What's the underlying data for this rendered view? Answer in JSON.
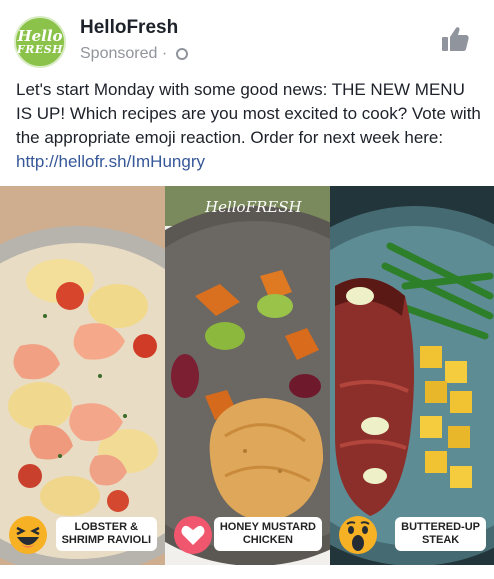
{
  "post": {
    "page_name": "HelloFresh",
    "logo_line1": "Hello",
    "logo_line2": "FRESH",
    "meta_text": "Sponsored · ",
    "caption_text": "Let's start Monday with some good news: THE NEW MENU IS UP! Which recipes are you most excited to cook? Vote with the appropriate emoji reaction. Order for next week here: ",
    "link_text": "http://hellofr.sh/ImHungry",
    "icons": [
      "globe-icon",
      "thumbs-up-icon"
    ]
  },
  "photos": [
    {
      "label_line1": "LOBSTER &",
      "label_line2": "SHRIMP RAVIOLI",
      "reaction": "haha-emoji"
    },
    {
      "label_line1": "HONEY MUSTARD",
      "label_line2": "CHICKEN",
      "reaction": "love-emoji"
    },
    {
      "label_line1": "BUTTERED-UP",
      "label_line2": "STEAK",
      "reaction": "wow-emoji"
    }
  ],
  "watermark": "HelloFRESH",
  "colors": {
    "brand": "#8bc34a",
    "link": "#365899",
    "reaction_yellow": "#f7b125",
    "love_pink": "#f0566e"
  }
}
